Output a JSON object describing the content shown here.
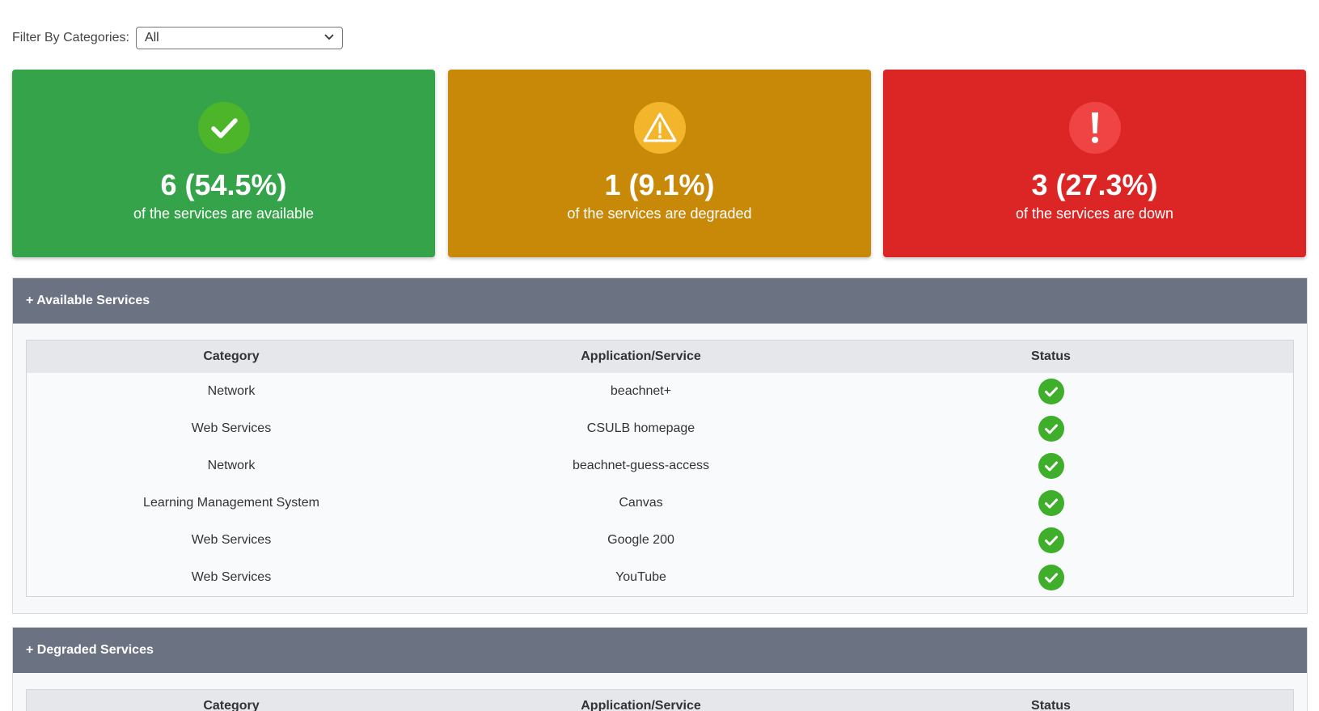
{
  "filter": {
    "label": "Filter By Categories:",
    "selected": "All"
  },
  "summary": {
    "available": {
      "count_text": "6 (54.5%)",
      "caption": "of the services are available",
      "color": "#34a34a",
      "icon": "check-icon"
    },
    "degraded": {
      "count_text": "1 (9.1%)",
      "caption": "of the services are degraded",
      "color": "#c98908",
      "icon": "warning-icon"
    },
    "down": {
      "count_text": "3 (27.3%)",
      "caption": "of the services are down",
      "color": "#dc2626",
      "icon": "exclamation-icon"
    }
  },
  "sections": {
    "available": {
      "title": "+ Available Services",
      "columns": [
        "Category",
        "Application/Service",
        "Status"
      ],
      "rows": [
        {
          "category": "Network",
          "service": "beachnet+",
          "status": "available"
        },
        {
          "category": "Web Services",
          "service": "CSULB homepage",
          "status": "available"
        },
        {
          "category": "Network",
          "service": "beachnet-guess-access",
          "status": "available"
        },
        {
          "category": "Learning Management System",
          "service": "Canvas",
          "status": "available"
        },
        {
          "category": "Web Services",
          "service": "Google 200",
          "status": "available"
        },
        {
          "category": "Web Services",
          "service": "YouTube",
          "status": "available"
        }
      ]
    },
    "degraded": {
      "title": "+ Degraded Services",
      "columns": [
        "Category",
        "Application/Service",
        "Status"
      ]
    }
  }
}
